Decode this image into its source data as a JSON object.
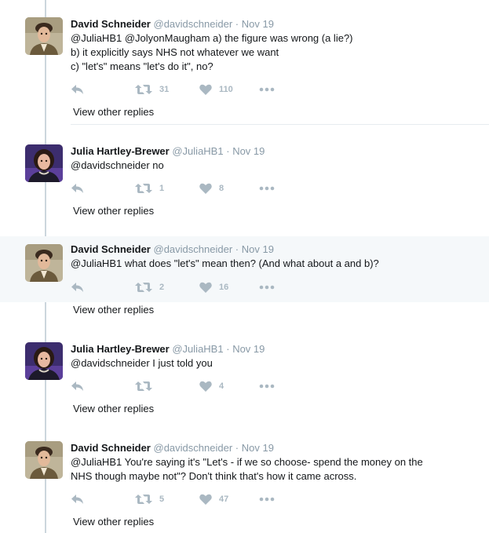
{
  "colors": {
    "thread_line": "#ccd6dd",
    "action_gray": "#aab8c2",
    "meta_gray": "#8899a6",
    "highlight_bg": "#f5f8fa"
  },
  "view_other_replies": "View other replies",
  "tweets": [
    {
      "author": "David Schneider",
      "handle": "@davidschneider",
      "dot": "·",
      "date": "Nov 19",
      "avatar_icon": "avatar-david-schneider",
      "lines": [
        "@JuliaHB1 @JolyonMaugham a) the figure was wrong (a lie?)",
        "b) it explicitly says NHS not whatever we want",
        "c) \"let's\" means \"let's do it\", no?"
      ],
      "retweets": "31",
      "likes": "110"
    },
    {
      "author": "Julia Hartley-Brewer",
      "handle": "@JuliaHB1",
      "dot": "·",
      "date": "Nov 19",
      "avatar_icon": "avatar-julia-hartley-brewer",
      "lines": [
        "@davidschneider no"
      ],
      "retweets": "1",
      "likes": "8"
    },
    {
      "author": "David Schneider",
      "handle": "@davidschneider",
      "dot": "·",
      "date": "Nov 19",
      "avatar_icon": "avatar-david-schneider",
      "lines": [
        "@JuliaHB1 what does \"let's\" mean then? (And what about a and b)?"
      ],
      "retweets": "2",
      "likes": "16"
    },
    {
      "author": "Julia Hartley-Brewer",
      "handle": "@JuliaHB1",
      "dot": "·",
      "date": "Nov 19",
      "avatar_icon": "avatar-julia-hartley-brewer",
      "lines": [
        "@davidschneider I just told you"
      ],
      "retweets": "",
      "likes": "4"
    },
    {
      "author": "David Schneider",
      "handle": "@davidschneider",
      "dot": "·",
      "date": "Nov 19",
      "avatar_icon": "avatar-david-schneider",
      "lines": [
        "@JuliaHB1 You're saying it's \"Let's - if we so choose- spend the money on the",
        "NHS though maybe not\"? Don't think that's how it came across."
      ],
      "retweets": "5",
      "likes": "47"
    }
  ]
}
